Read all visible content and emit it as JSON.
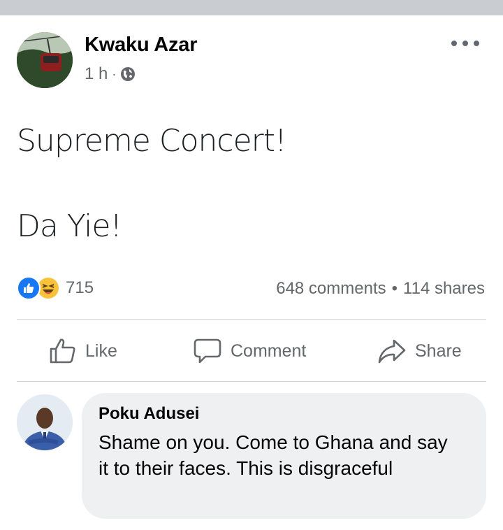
{
  "post": {
    "author": "Kwaku Azar",
    "time": "1 h",
    "separator": "·",
    "privacy_icon": "globe-icon",
    "line1": "Supreme Concert!",
    "line2": "Da Yie!"
  },
  "stats": {
    "reaction_icons": [
      "like-reaction-icon",
      "haha-reaction-icon"
    ],
    "reaction_count": "715",
    "comments": "648 comments",
    "separator": "•",
    "shares": "114 shares"
  },
  "actions": {
    "like": "Like",
    "comment": "Comment",
    "share": "Share"
  },
  "comment": {
    "author": "Poku Adusei",
    "text": "Shame on you. Come to Ghana and say it to their faces. This is disgraceful"
  },
  "colors": {
    "like_blue": "#1877f2",
    "haha_yellow": "#f7c33a",
    "muted_text": "#65676b",
    "bubble_bg": "#eef0f2"
  }
}
